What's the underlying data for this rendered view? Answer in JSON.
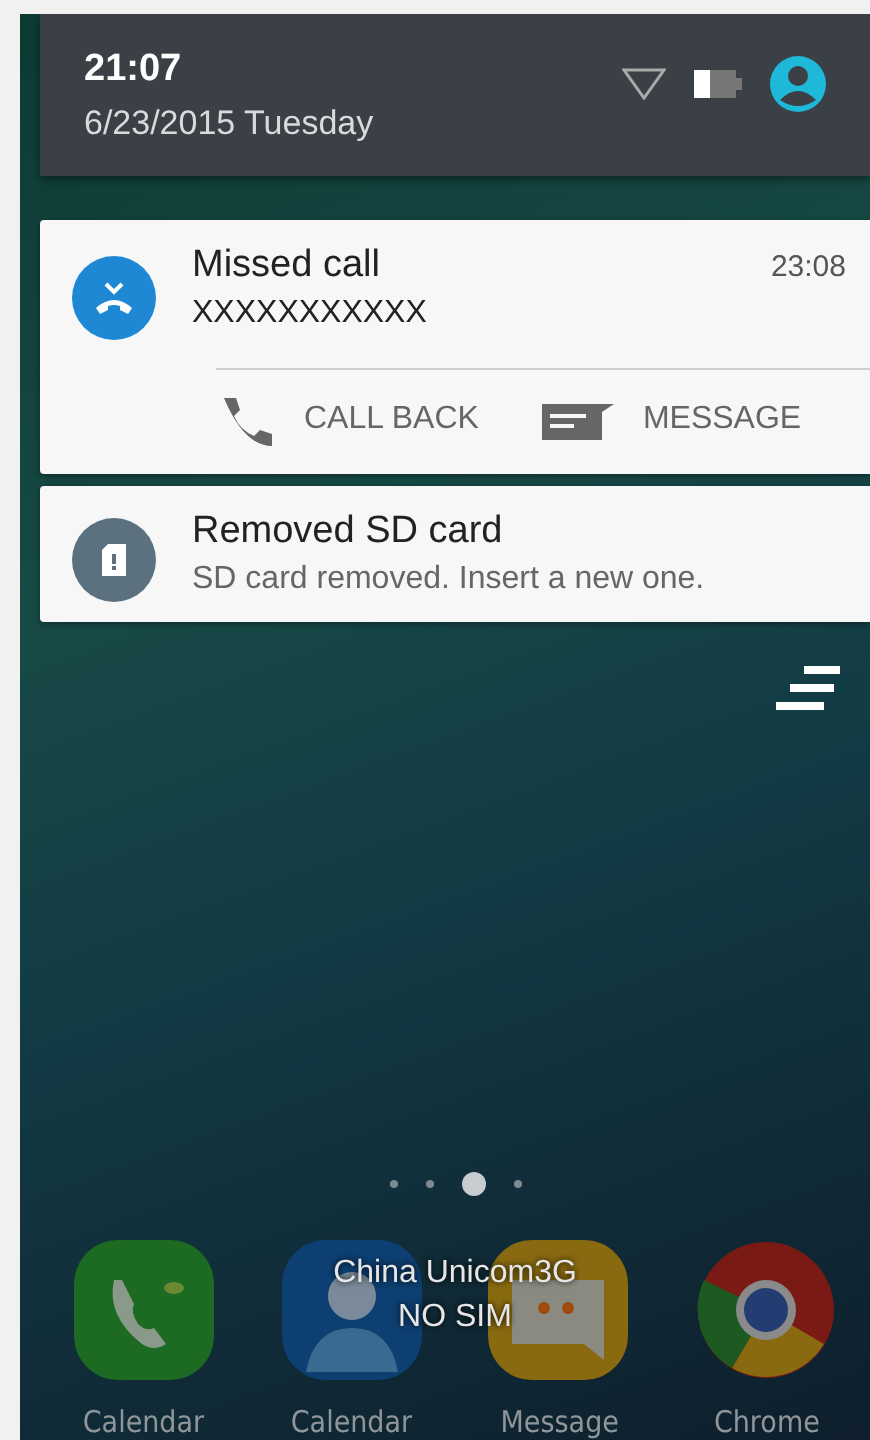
{
  "header": {
    "time": "21:07",
    "date": "6/23/2015 Tuesday"
  },
  "notifications": [
    {
      "kind": "call",
      "title": "Missed call",
      "text": "XXXXXXXXXXX",
      "time": "23:08",
      "actions": [
        {
          "kind": "call",
          "label": "CALL BACK"
        },
        {
          "kind": "message",
          "label": "MESSAGE"
        }
      ]
    },
    {
      "kind": "sd",
      "title": "Removed SD card",
      "text": "SD card removed. Insert a new one."
    }
  ],
  "page_dots": [
    {
      "selected": false
    },
    {
      "selected": false
    },
    {
      "selected": true
    },
    {
      "selected": false
    }
  ],
  "carrier": {
    "name": "China Unicom3G",
    "sim": "NO SIM"
  },
  "dock": [
    {
      "kind": "phone",
      "label": "Calendar"
    },
    {
      "kind": "contacts",
      "label": "Calendar"
    },
    {
      "kind": "message",
      "label": "Message"
    },
    {
      "kind": "chrome",
      "label": "Chrome"
    }
  ]
}
